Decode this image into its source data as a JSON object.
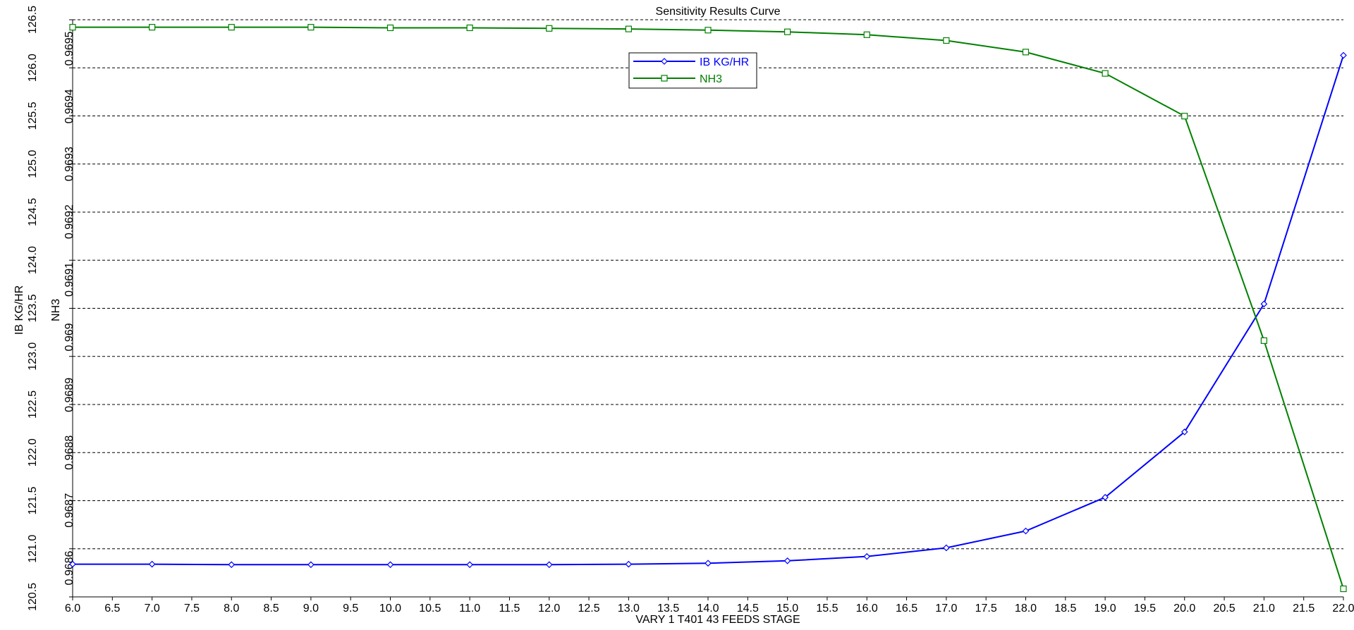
{
  "colors": {
    "ib": "#0000ff",
    "nh3": "#008000",
    "grid": "#000000",
    "background": "#ffffff"
  },
  "chart_data": {
    "type": "line",
    "title": "Sensitivity Results Curve",
    "xlabel": "VARY   1 T401 43 FEEDS STAGE",
    "ylabel_left": "IB KG/HR",
    "ylabel_right": "NH3",
    "xlim": [
      6.0,
      22.0
    ],
    "ylim_left": [
      120.5,
      126.5
    ],
    "ylim_right": [
      0.96855,
      0.96955
    ],
    "x_ticks": [
      "6.0",
      "6.5",
      "7.0",
      "7.5",
      "8.0",
      "8.5",
      "9.0",
      "9.5",
      "10.0",
      "10.5",
      "11.0",
      "11.5",
      "12.0",
      "12.5",
      "13.0",
      "13.5",
      "14.0",
      "14.5",
      "15.0",
      "15.5",
      "16.0",
      "16.5",
      "17.0",
      "17.5",
      "18.0",
      "18.5",
      "19.0",
      "19.5",
      "20.0",
      "20.5",
      "21.0",
      "21.5",
      "22.0"
    ],
    "y_ticks_left": [
      "120.5",
      "121.0",
      "121.5",
      "122.0",
      "122.5",
      "123.0",
      "123.5",
      "124.0",
      "124.5",
      "125.0",
      "125.5",
      "126.0",
      "126.5"
    ],
    "y_ticks_right": [
      "0.9686",
      "0.9687",
      "0.9688",
      "0.9689",
      "0.969",
      "0.9691",
      "0.9692",
      "0.9693",
      "0.9694",
      "0.9695"
    ],
    "grid": true,
    "legend_position": "top-center",
    "x": [
      6,
      7,
      8,
      9,
      10,
      11,
      12,
      13,
      14,
      15,
      16,
      17,
      18,
      19,
      20,
      21,
      22
    ],
    "series": [
      {
        "name": "IB KG/HR",
        "axis": "left",
        "marker": "diamond",
        "values": [
          120.84,
          120.84,
          120.835,
          120.835,
          120.835,
          120.835,
          120.835,
          120.84,
          120.85,
          120.875,
          120.92,
          121.01,
          121.185,
          121.535,
          122.215,
          123.545,
          126.13
        ]
      },
      {
        "name": "NH3",
        "axis": "right",
        "marker": "square",
        "values": [
          0.969537,
          0.969537,
          0.969537,
          0.969537,
          0.969536,
          0.969536,
          0.969535,
          0.969534,
          0.969532,
          0.969529,
          0.969524,
          0.969514,
          0.969494,
          0.969457,
          0.969383,
          0.968994,
          0.968564
        ]
      }
    ]
  }
}
